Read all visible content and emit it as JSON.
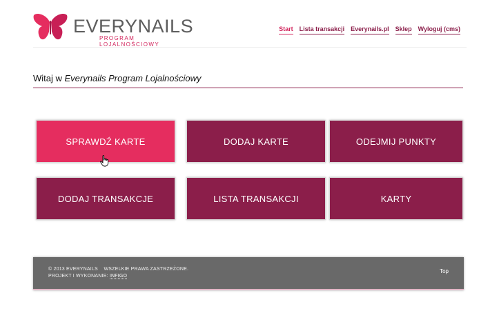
{
  "brand": {
    "name": "EVERYNAILS",
    "subtitle": "PROGRAM LOJALNOŚCIOWY",
    "logo_icon": "butterfly-icon",
    "accent_color": "#e52d5f",
    "primary_color": "#8b1e4a"
  },
  "nav": {
    "items": [
      {
        "label": "Start",
        "active": true
      },
      {
        "label": "Lista transakcji"
      },
      {
        "label": "Everynails.pl"
      },
      {
        "label": "Sklep"
      },
      {
        "label": "Wyloguj (cms)"
      }
    ]
  },
  "welcome": {
    "prefix": "Witaj w",
    "emphasis": "Everynails Program Lojalnościowy"
  },
  "tiles": [
    {
      "label": "SPRAWDŹ KARTE",
      "active": true
    },
    {
      "label": "DODAJ KARTE"
    },
    {
      "label": "ODEJMIJ PUNKTY"
    },
    {
      "label": "DODAJ TRANSAKCJE"
    },
    {
      "label": "LISTA TRANSAKCJI"
    },
    {
      "label": "KARTY"
    }
  ],
  "footer": {
    "copyright": "© 2013 EVERYNAILS",
    "rights": "WSZELKIE PRAWA ZASTRZEŻONE.",
    "credit_prefix": "PROJEKT I WYKONANIE:",
    "credit_link": "INFIGO",
    "top_label": "Top"
  },
  "cursor_icon": "hand-pointer-icon"
}
